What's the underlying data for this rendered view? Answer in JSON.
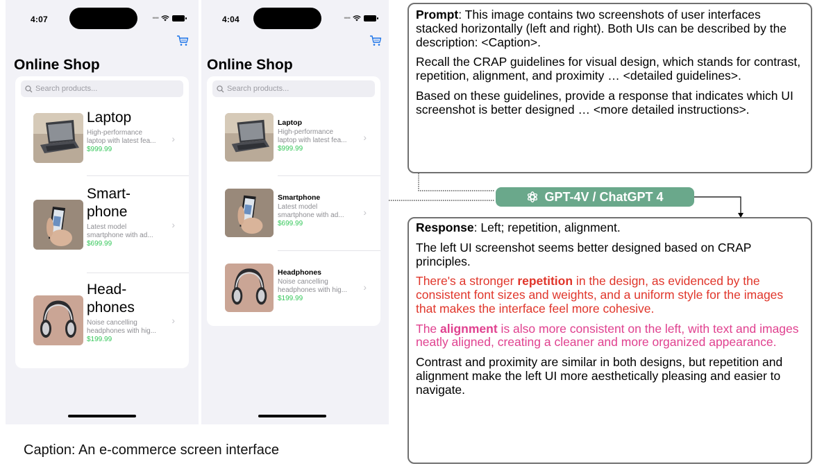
{
  "left_ui": {
    "time": "4:07",
    "title": "Online Shop",
    "search_placeholder": "Search products...",
    "products": [
      {
        "name_line1": "Laptop",
        "name_line2": "",
        "desc_line1": "High-performance",
        "desc_line2": "laptop with latest fea...",
        "price": "$999.99"
      },
      {
        "name_line1": "Smart-",
        "name_line2": "phone",
        "desc_line1": "Latest model",
        "desc_line2": "smartphone with ad...",
        "price": "$699.99"
      },
      {
        "name_line1": "Head-",
        "name_line2": "phones",
        "desc_line1": "Noise cancelling",
        "desc_line2": "headphones with hig...",
        "price": "$199.99"
      }
    ]
  },
  "right_ui": {
    "time": "4:04",
    "title": "Online Shop",
    "search_placeholder": "Search products...",
    "products": [
      {
        "name": "Laptop",
        "desc_line1": "High-performance",
        "desc_line2": "laptop with latest fea...",
        "price": "$999.99"
      },
      {
        "name": "Smartphone",
        "desc_line1": "Latest model",
        "desc_line2": "smartphone with ad...",
        "price": "$699.99"
      },
      {
        "name": "Headphones",
        "desc_line1": "Noise cancelling",
        "desc_line2": "headphones with hig...",
        "price": "$199.99"
      }
    ]
  },
  "caption": "Caption: An e-commerce screen interface",
  "prompt": {
    "label": "Prompt",
    "line1": ": This image contains two screenshots of user interfaces stacked horizontally (left and right). Both UIs can be described by the description: <Caption>.",
    "line2": "Recall the CRAP guidelines for visual design, which stands for contrast, repetition, alignment, and proximity … <detailed guidelines>.",
    "line3": "Based on these guidelines, provide a response that indicates which UI screenshot is better designed … <more detailed instructions>."
  },
  "model_label": "GPT-4V / ChatGPT 4",
  "response": {
    "label": "Response",
    "summary": ": Left; repetition, alignment.",
    "p1": "The left UI screenshot seems better designed based on CRAP principles.",
    "p2_pre": "There's a stronger ",
    "p2_bold": "repetition",
    "p2_post": " in the design, as evidenced by the consistent font sizes and weights, and a uniform style for the images that makes the interface feel more cohesive.",
    "p3_pre": "The ",
    "p3_bold": "alignment",
    "p3_post": " is also more consistent on the left, with text and images neatly aligned, creating a cleaner and more organized appearance.",
    "p4": "Contrast and proximity are similar in both designs, but repetition and alignment make the left UI more aesthetically pleasing and easier to navigate."
  },
  "colors": {
    "accent_blue": "#1a73e8",
    "price_green": "#34c759",
    "gpt_green": "#6aa88b",
    "repetition_red": "#e0352a",
    "alignment_pink": "#e0418f"
  },
  "icons": {
    "cart": "cart-icon",
    "search": "search-icon",
    "chevron": "chevron-right-icon",
    "wifi": "wifi-icon",
    "battery": "battery-icon",
    "openai": "openai-logo-icon"
  }
}
